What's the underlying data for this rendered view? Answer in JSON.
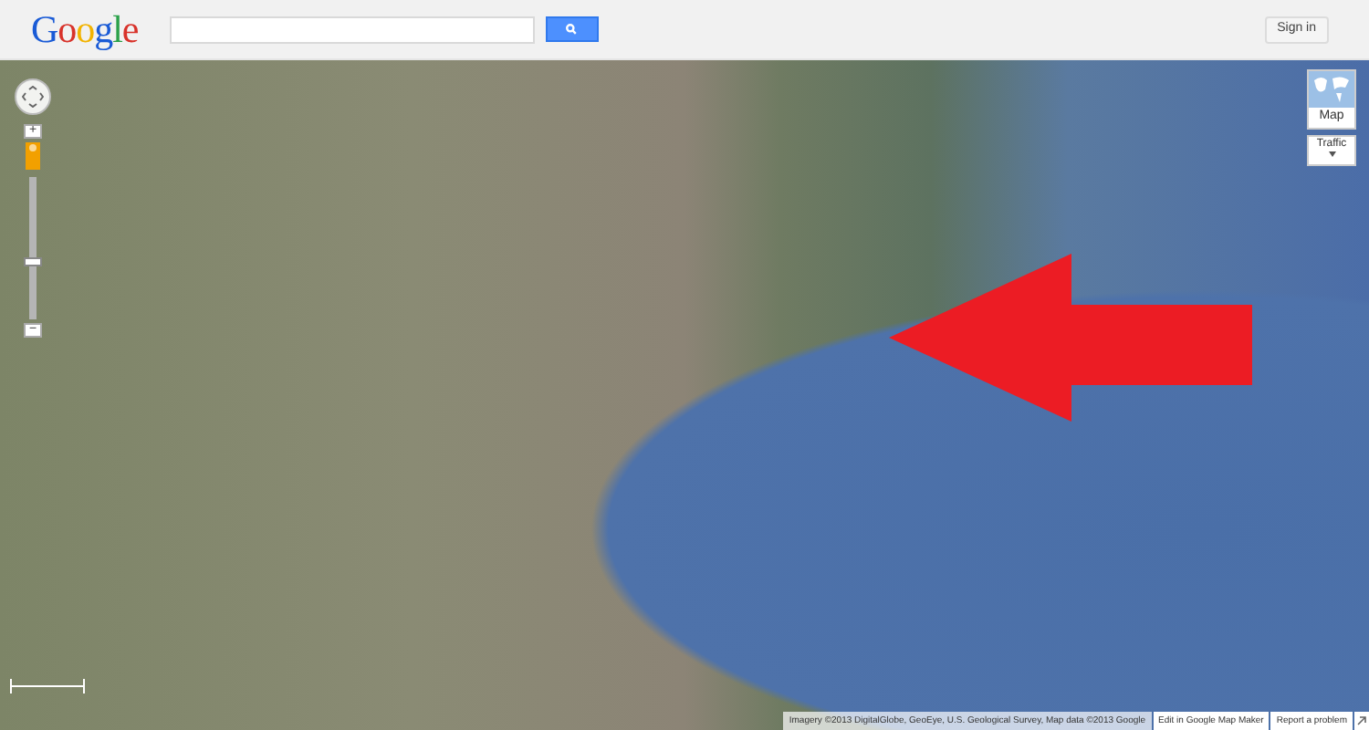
{
  "header": {
    "logo": "Google",
    "sign_in": "Sign in"
  },
  "map": {
    "zoom_in": "+",
    "zoom_slider": {
      "level": 0.4
    },
    "zoom_out": "−",
    "map_type_button": "Map",
    "traffic_button": "Traffic",
    "attribution": "Imagery ©2013 DigitalGlobe, GeoEye, U.S. Geological Survey, Map data ©2013 Google",
    "links": [
      "Edit in Google Map Maker",
      "Report a problem"
    ]
  }
}
